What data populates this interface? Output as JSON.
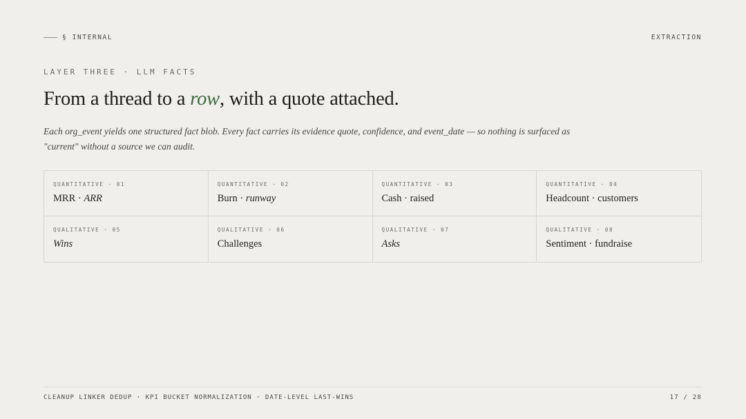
{
  "header": {
    "section_label": "§ INTERNAL",
    "right_label": "EXTRACTION"
  },
  "eyebrow": "LAYER THREE · LLM FACTS",
  "headline": {
    "before": "From a thread to a ",
    "emphasis": "row",
    "after": ", with a quote attached."
  },
  "lede": "Each org_event yields one structured fact blob. Every fact carries its evidence quote, confidence, and event_date — so nothing is surfaced as \"current\" without a source we can audit.",
  "cards": [
    {
      "tag": "QUANTITATIVE · 01",
      "plain": "MRR · ",
      "italic": "ARR",
      "after": ""
    },
    {
      "tag": "QUANTITATIVE · 02",
      "plain": "Burn · ",
      "italic": "runway",
      "after": ""
    },
    {
      "tag": "QUANTITATIVE · 03",
      "plain": "Cash · raised",
      "italic": "",
      "after": ""
    },
    {
      "tag": "QUANTITATIVE · 04",
      "plain": "Headcount · customers",
      "italic": "",
      "after": ""
    },
    {
      "tag": "QUALITATIVE · 05",
      "plain": "",
      "italic": "Wins",
      "after": ""
    },
    {
      "tag": "QUALITATIVE · 06",
      "plain": "Challenges",
      "italic": "",
      "after": ""
    },
    {
      "tag": "QUALITATIVE · 07",
      "plain": "",
      "italic": "Asks",
      "after": ""
    },
    {
      "tag": "QUALITATIVE · 08",
      "plain": "Sentiment · fundraise",
      "italic": "",
      "after": ""
    }
  ],
  "footer": {
    "left": "CLEANUP LINKER DEDUP · KPI BUCKET NORMALIZATION · DATE-LEVEL LAST-WINS",
    "page": "17 / 28"
  },
  "colors": {
    "background": "#f0efeb",
    "accent": "#3f6a40",
    "text": "#1f1f1c",
    "border": "#d9d7cf"
  }
}
